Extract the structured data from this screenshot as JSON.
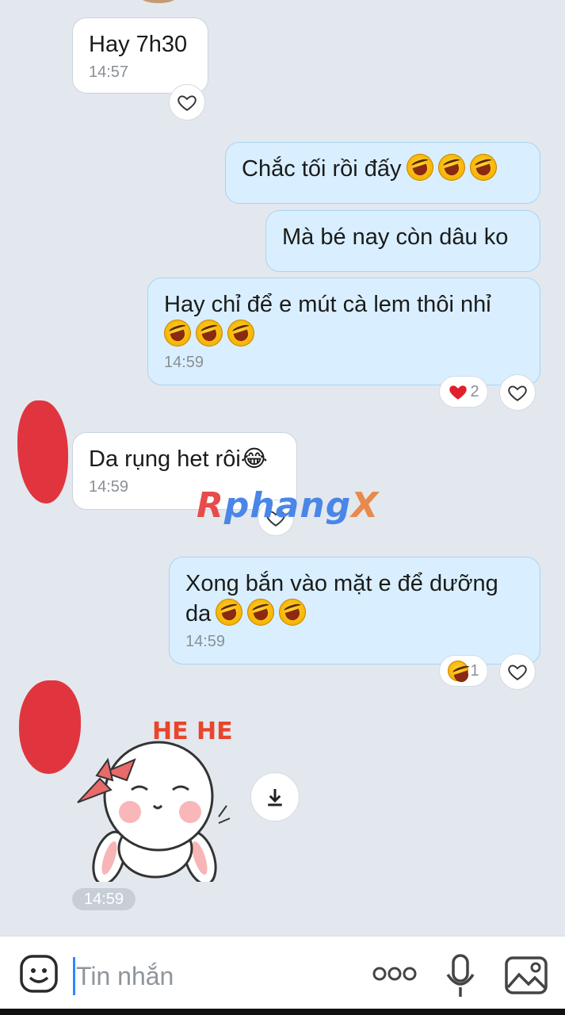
{
  "messages": [
    {
      "id": "m1",
      "side": "in",
      "text": "Hay 7h30",
      "time": "14:57"
    },
    {
      "id": "m2",
      "side": "out",
      "text": "Chắc tối rồi đấy",
      "emojis": 3
    },
    {
      "id": "m3",
      "side": "out",
      "text": "Mà bé nay còn dâu ko"
    },
    {
      "id": "m4",
      "side": "out",
      "text": "Hay chỉ để e mút cà lem thôi nhỉ",
      "emojis": 3,
      "time": "14:59",
      "reaction_count": "2"
    },
    {
      "id": "m5",
      "side": "in",
      "text": "Da rụng het rôi😂",
      "time": "14:59"
    },
    {
      "id": "m6",
      "side": "out",
      "text": "Xong bắn vào mặt e để dưỡng da",
      "emojis": 3,
      "time": "14:59",
      "reaction_count": "1"
    }
  ],
  "sticker": {
    "time": "14:59",
    "caption": "HE HE"
  },
  "watermark": {
    "part1": "R",
    "part2": "phang",
    "part3": "X"
  },
  "input": {
    "placeholder": "Tin nhắn"
  },
  "colors": {
    "incoming_bubble": "#ffffff",
    "outgoing_bubble": "#d9efff",
    "background": "#e3e8ee",
    "accent": "#2b8aff"
  }
}
